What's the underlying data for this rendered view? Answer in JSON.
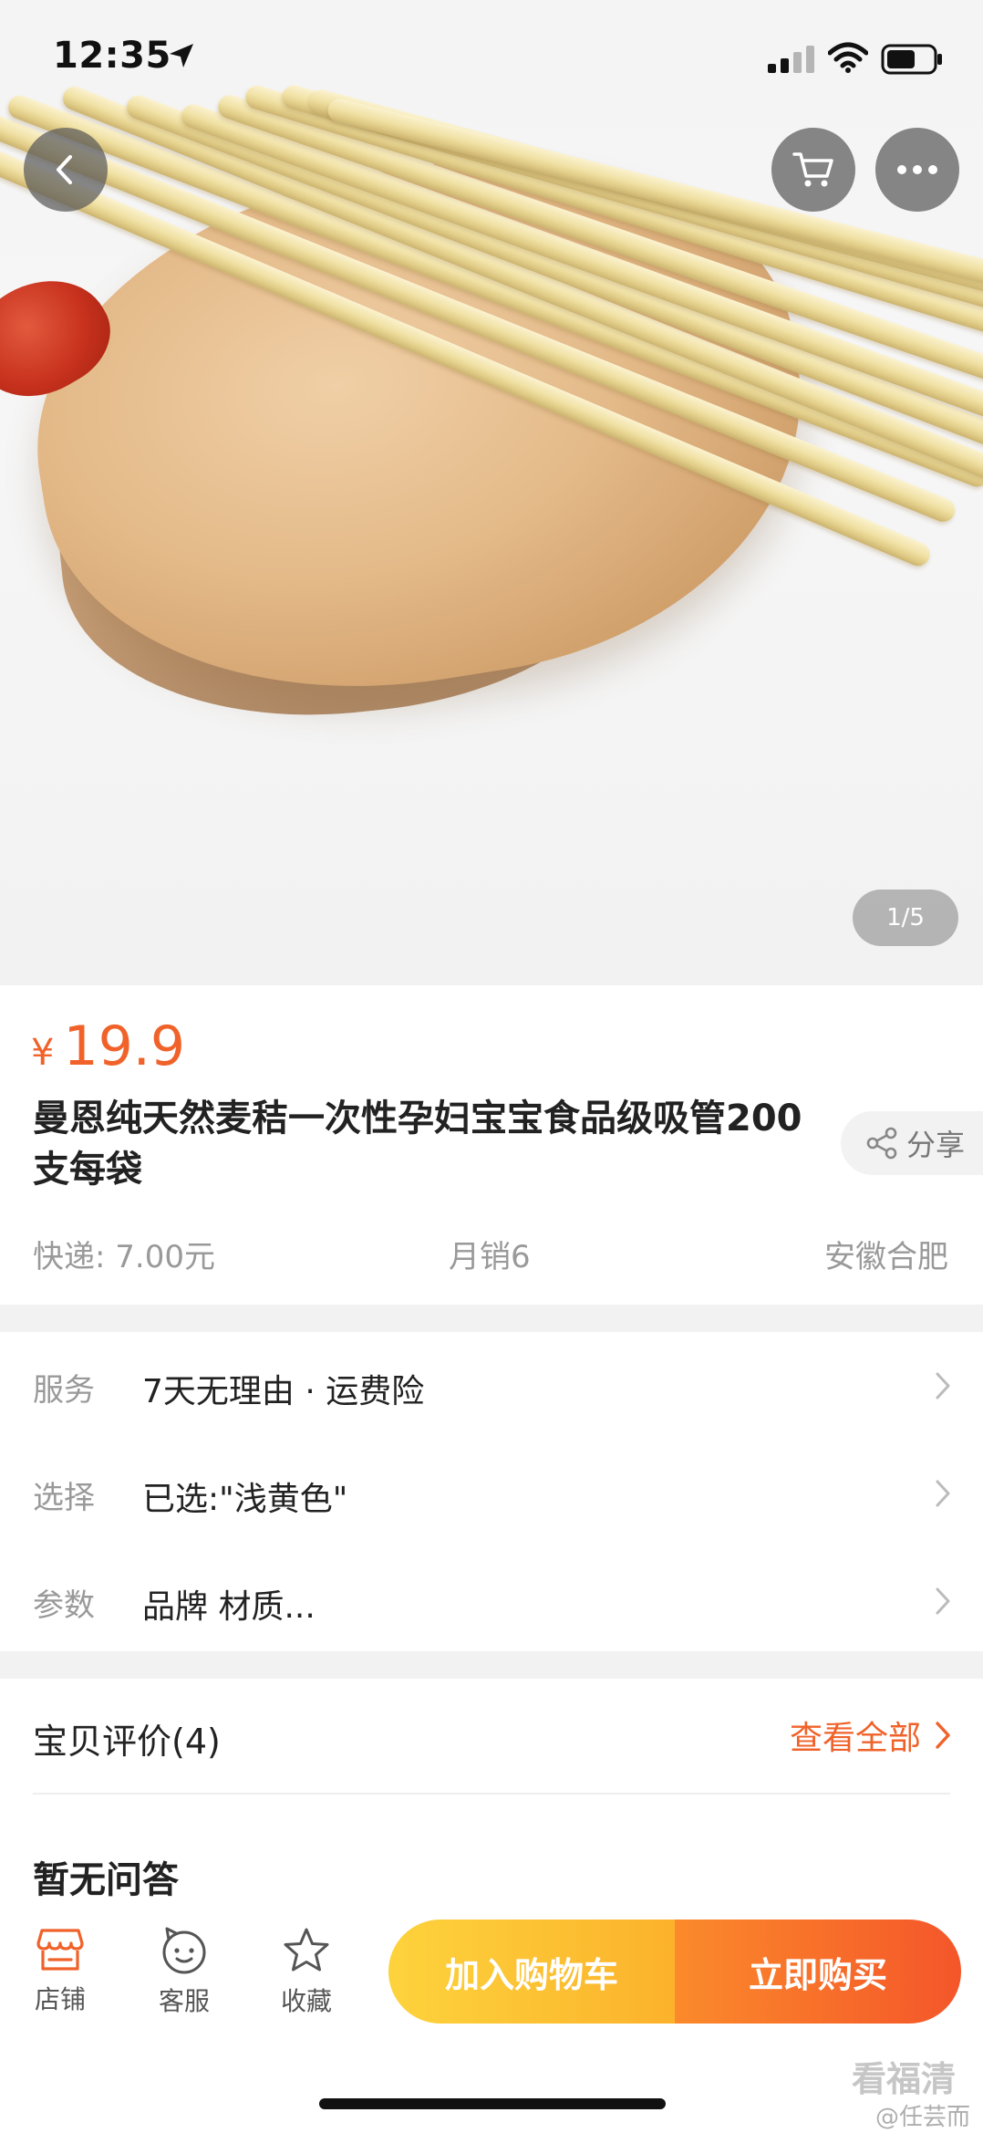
{
  "status_bar": {
    "time": "12:35"
  },
  "gallery": {
    "page_indicator": "1/5"
  },
  "product": {
    "price_symbol": "¥",
    "price": "19.9",
    "title": "曼恩纯天然麦秸一次性孕妇宝宝食品级吸管200支每袋",
    "share_label": "分享",
    "shipping": "快递: 7.00元",
    "monthly_sales": "月销6",
    "location": "安徽合肥"
  },
  "attributes": [
    {
      "label": "服务",
      "value": "7天无理由 · 运费险"
    },
    {
      "label": "选择",
      "value": "已选:\"浅黄色\""
    },
    {
      "label": "参数",
      "value": "品牌 材质..."
    }
  ],
  "reviews": {
    "title": "宝贝评价(4)",
    "view_all": "查看全部"
  },
  "qa": {
    "empty_text": "暂无问答"
  },
  "toolbar": {
    "store_label": "店铺",
    "service_label": "客服",
    "favorite_label": "收藏",
    "add_to_cart": "加入购物车",
    "buy_now": "立即购买"
  },
  "watermark": {
    "brand": "看福清",
    "handle": "@任芸而"
  },
  "colors": {
    "accent": "#f0622a",
    "cart_button": "#fcc232",
    "buy_button": "#f66f2b"
  }
}
